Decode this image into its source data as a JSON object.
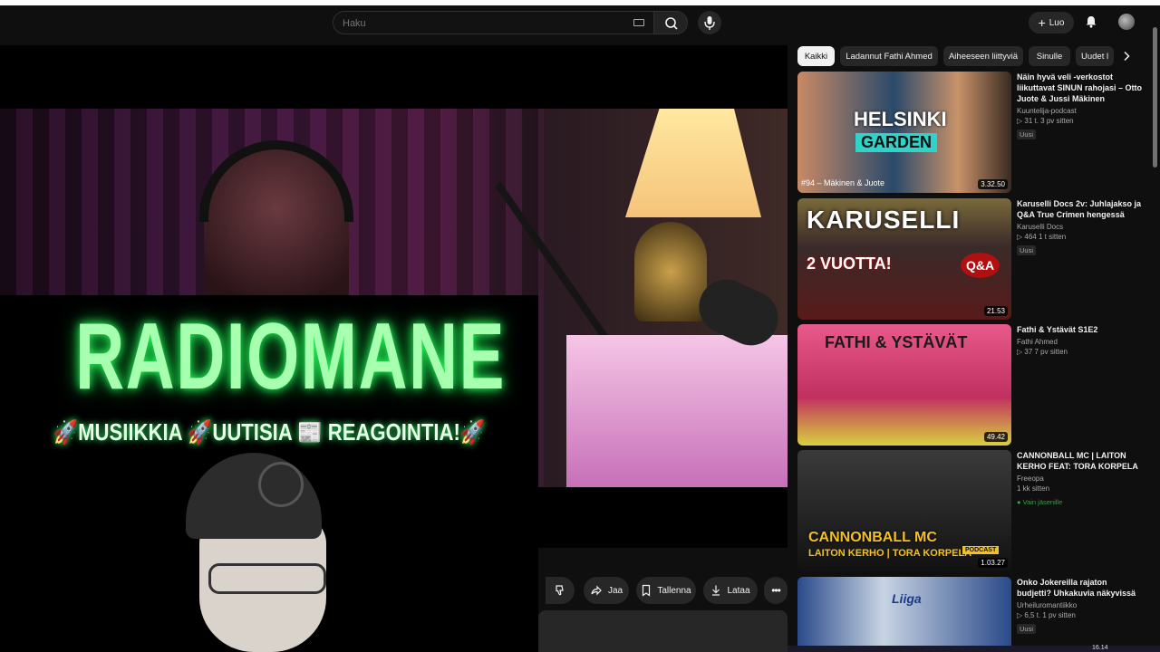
{
  "header": {
    "search_placeholder": "Haku",
    "create_label": "Luo"
  },
  "video": {
    "overlay_title": "RADIOMANE",
    "overlay_tagline": "🚀MUSIIKKIA 🚀UUTISIA 📰 REAGOINTIA!🚀"
  },
  "actions": {
    "share_label": "Jaa",
    "save_label": "Tallenna",
    "download_label": "Lataa"
  },
  "chips": [
    "Kaikki",
    "Ladannut Fathi Ahmed",
    "Aiheeseen liittyviä",
    "Sinulle",
    "Uudet l"
  ],
  "recommended": [
    {
      "title": "Näin hyvä veli -verkostot liikuttavat SINUN rahojasi – Otto Juote & Jussi Mäkinen",
      "channel": "Kuuntelija-podcast",
      "meta": "▷ 31 t.   3 pv sitten",
      "badge": "Uusi",
      "duration": "3.32.50",
      "thumb_text_1": "HELSINKI",
      "thumb_text_2": "GARDEN",
      "thumb_caption": "#94 – Mäkinen & Juote"
    },
    {
      "title": "Karuselli Docs 2v: Juhlajakso ja Q&A True Crimen hengessä",
      "channel": "Karuselli Docs",
      "meta": "▷ 464   1 t sitten",
      "badge": "Uusi",
      "duration": "21.53",
      "thumb_text_1": "KARUSELLI",
      "thumb_text_2": "2 VUOTTA!",
      "thumb_caption": "Q&A"
    },
    {
      "title": "Fathi & Ystävät S1E2",
      "channel": "Fathi Ahmed",
      "meta": "▷ 37   7 pv sitten",
      "badge": "",
      "duration": "49.42",
      "thumb_text_1": "FATHI & YSTÄVÄT",
      "thumb_text_2": "",
      "thumb_caption": ""
    },
    {
      "title": "CANNONBALL MC | LAITON KERHO FEAT: TORA KORPELA",
      "channel": "Freeopa",
      "meta": "1 kk sitten",
      "badge": "Vain jäsenille",
      "duration": "1.03.27",
      "thumb_text_1": "CANNONBALL MC",
      "thumb_text_2": "LAITON KERHO | TORA KORPELA",
      "thumb_caption": "PODCAST"
    },
    {
      "title": "Onko Jokereilla rajaton budjetti? Uhkakuvia näkyvissä",
      "channel": "Urheiluromantiikko",
      "meta": "▷ 6,5 t.   1 pv sitten",
      "badge": "Uusi",
      "duration": "",
      "thumb_text_1": "Liiga",
      "thumb_text_2": "",
      "thumb_caption": ""
    }
  ],
  "system": {
    "clock": "16.14"
  },
  "colors": {
    "background": "#0f0f0f",
    "chip": "#272727",
    "neon_green": "#a7ffb0",
    "members_green": "#2ba640"
  }
}
